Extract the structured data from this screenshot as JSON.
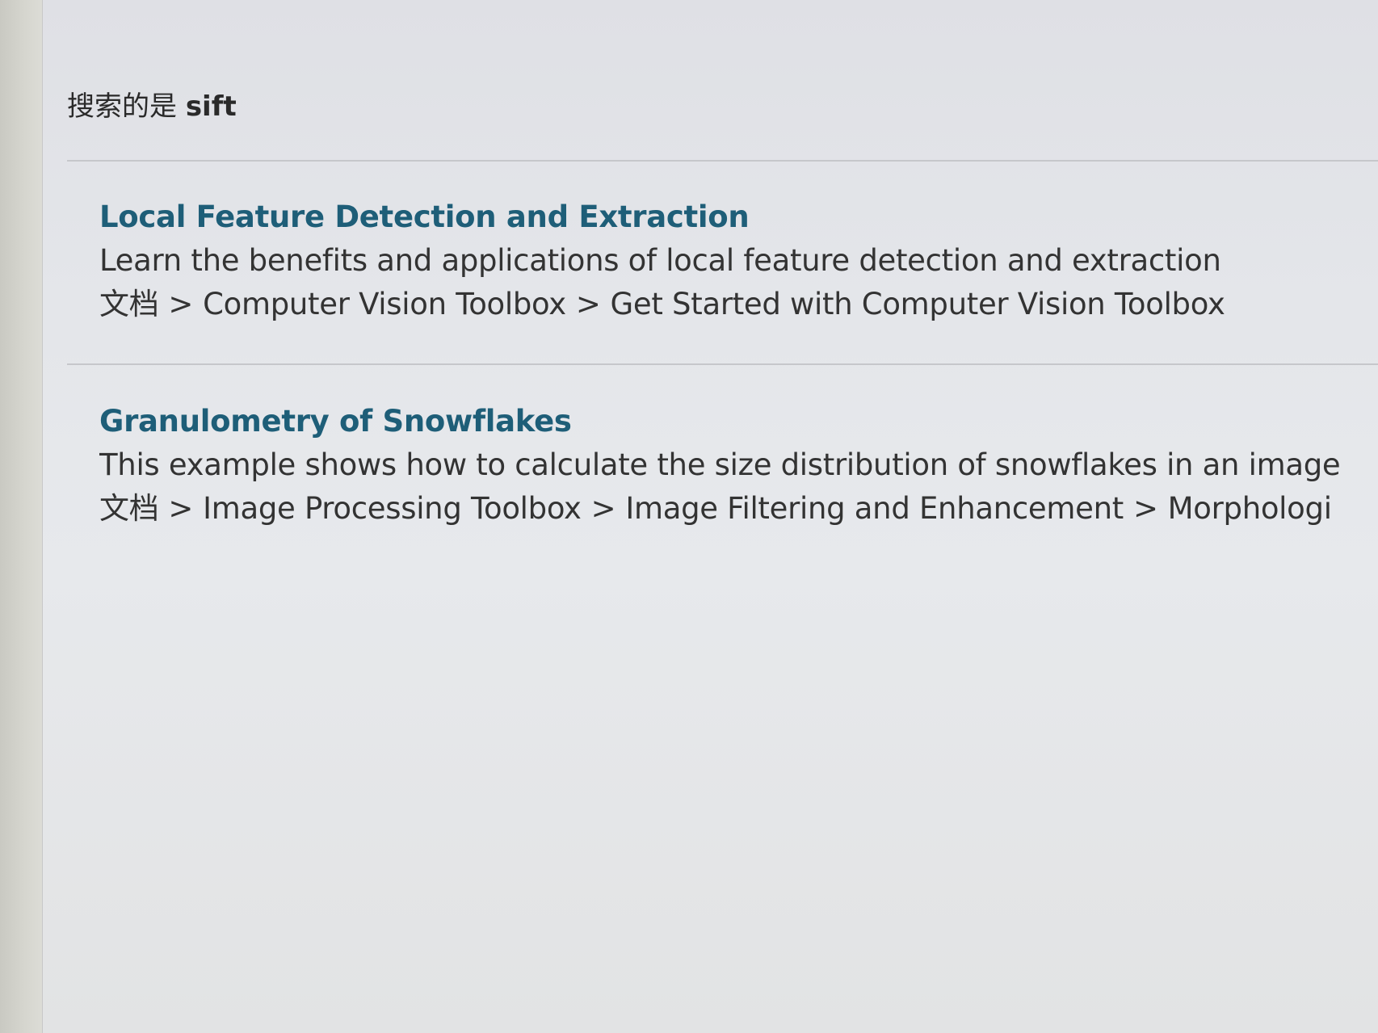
{
  "search": {
    "prefix": "搜索的是",
    "query": "sift"
  },
  "results": [
    {
      "title": "Local Feature Detection and Extraction",
      "description": "Learn the benefits and applications of local feature detection and extraction",
      "breadcrumb": [
        "文档",
        "Computer Vision Toolbox",
        "Get Started with Computer Vision Toolbox"
      ]
    },
    {
      "title": "Granulometry of Snowflakes",
      "description": "This example shows how to calculate the size distribution of snowflakes in an image",
      "breadcrumb": [
        "文档",
        "Image Processing Toolbox",
        "Image Filtering and Enhancement",
        "Morphologi"
      ]
    }
  ],
  "breadcrumb_separator": ">",
  "colors": {
    "link": "#1e5e78",
    "text": "#333333",
    "background": "#e4e6ea"
  }
}
